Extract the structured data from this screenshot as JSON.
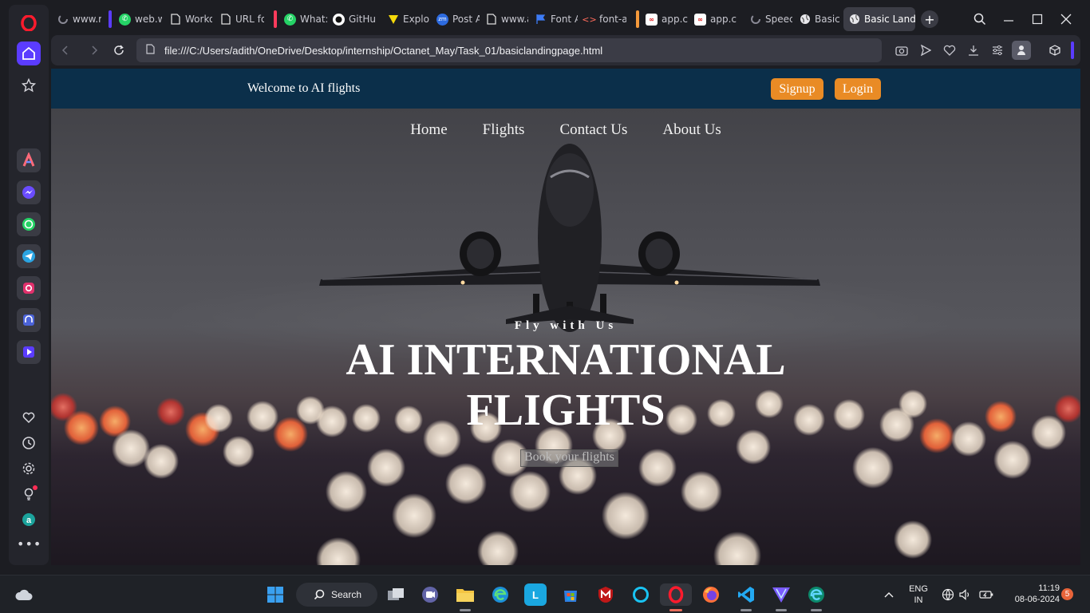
{
  "browser": {
    "tabs": [
      {
        "label": "www.r",
        "icon": "loading-icon"
      },
      {
        "label": "web.w",
        "icon": "whatsapp-icon"
      },
      {
        "label": "Worko",
        "icon": "document-icon"
      },
      {
        "label": "URL fo",
        "icon": "document-icon"
      },
      {
        "label": "What:",
        "icon": "whatsapp-icon"
      },
      {
        "label": "GitHu",
        "icon": "github-icon"
      },
      {
        "label": "Explo",
        "icon": "vite-icon"
      },
      {
        "label": "Post A",
        "icon": "zoho-icon"
      },
      {
        "label": "www.a",
        "icon": "document-icon"
      },
      {
        "label": "Font A",
        "icon": "flag-icon"
      },
      {
        "label": "font-a",
        "icon": "code-icon"
      },
      {
        "label": "app.cr",
        "icon": "infinity-icon"
      },
      {
        "label": "app.cr",
        "icon": "infinity-icon"
      },
      {
        "label": "Speec",
        "icon": "loading-icon"
      },
      {
        "label": "Basic",
        "icon": "globe-icon"
      },
      {
        "label": "Basic Landir",
        "icon": "globe-icon"
      }
    ],
    "active_tab_index": 15,
    "url": "file:///C:/Users/adith/OneDrive/Desktop/internship/Octanet_May/Task_01/basiclandingpage.html"
  },
  "page": {
    "welcome": "Welcome to AI flights",
    "signup": "Signup",
    "login": "Login",
    "menu": [
      "Home",
      "Flights",
      "Contact Us",
      "About Us"
    ],
    "tagline": "Fly with Us",
    "headline_line1": "AI INTERNATIONAL",
    "headline_line2": "FLIGHTS",
    "cta": "Book your flights"
  },
  "taskbar": {
    "search_label": "Search",
    "lang_line1": "ENG",
    "lang_line2": "IN",
    "time": "11:19",
    "date": "08-06-2024",
    "notifications": "5"
  },
  "colors": {
    "opera_red": "#ff1b2d",
    "accent_purple": "#5b3cff",
    "page_topbar": "#0b2f4a",
    "button_orange": "#e98b25"
  }
}
